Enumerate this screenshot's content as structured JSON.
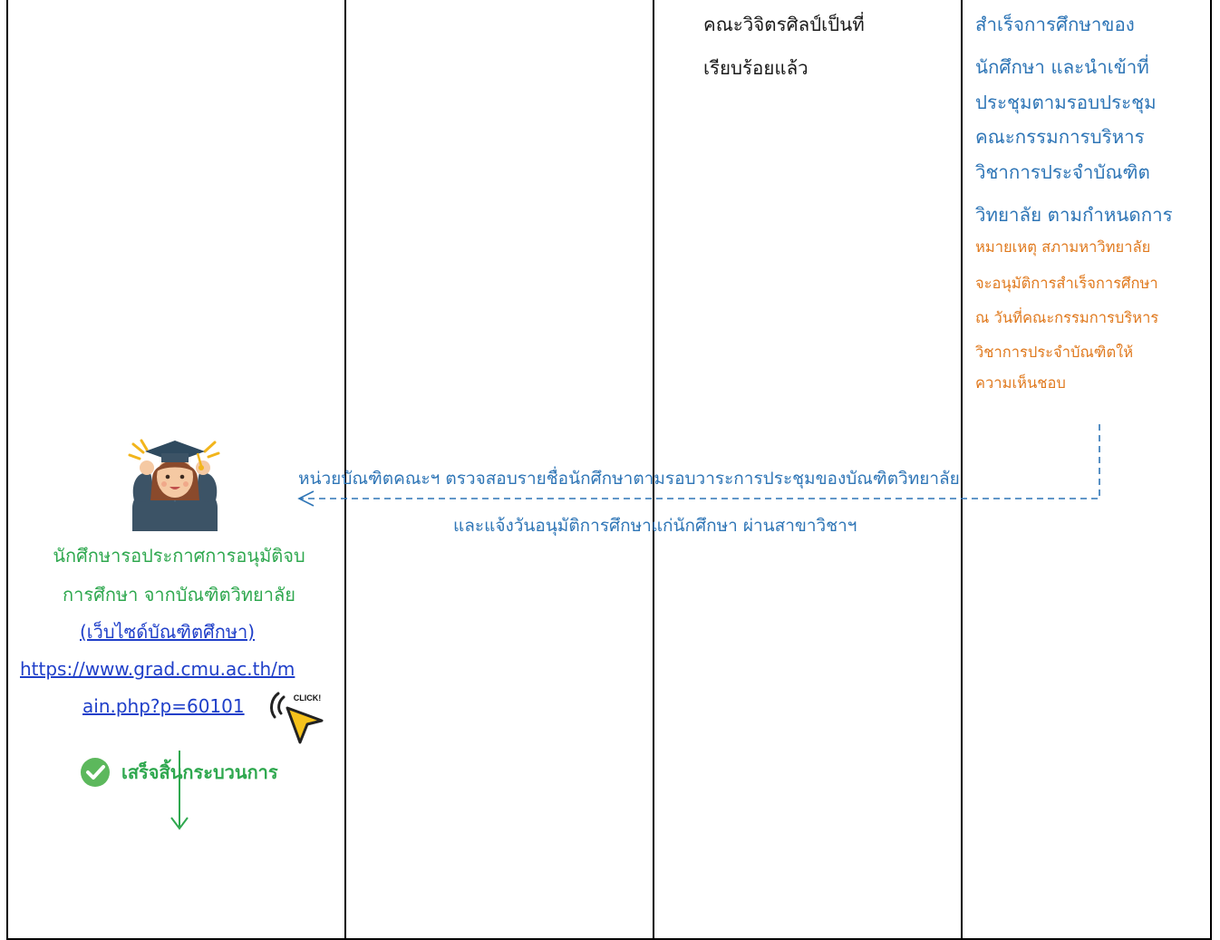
{
  "col3": {
    "lines": [
      "คณะวิจิตรศิลป์เป็นที่",
      "เรียบร้อยแล้ว"
    ]
  },
  "col4": {
    "blue_lines": [
      "สำเร็จการศึกษาของ",
      "นักศึกษา และนำเข้าที่",
      "ประชุมตามรอบประชุม",
      "คณะกรรมการบริหาร",
      "วิชาการประจำบัณฑิต",
      "วิทยาลัย ตามกำหนดการ"
    ],
    "note_lines": [
      "หมายเหตุ สภามหาวิทยาลัย",
      "จะอนุมัติการสำเร็จการศึกษา",
      "ณ วันที่คณะกรรมการบริหาร",
      "วิชาการประจำบัณฑิตให้",
      "ความเห็นชอบ"
    ]
  },
  "flow": {
    "line1": "หน่วยบัณฑิตคณะฯ ตรวจสอบรายชื่อนักศึกษาตามรอบวาระการประชุมของบัณฑิตวิทยาลัย",
    "line2": "และแจ้งวันอนุมัติการศึกษาแก่นักศึกษา ผ่านสาขาวิชาฯ"
  },
  "col1": {
    "green_lines": [
      "นักศึกษารอประกาศการอนุมัติจบ",
      "การศึกษา จากบัณฑิตวิทยาลัย"
    ],
    "link_label": "(เว็บไซด์บัณฑิตศึกษา)",
    "url_line1": "https://www.grad.cmu.ac.th/m",
    "url_line2": "ain.php?p=60101",
    "click_text": "CLICK!",
    "done_label": "เสร็จสิ้นกระบวนการ"
  },
  "colors": {
    "blue": "#2e75b6",
    "orange": "#e07a1f",
    "green": "#2fa84f",
    "link": "#1f3fc9"
  },
  "icons": [
    "graduate-icon",
    "click-cursor-icon",
    "down-arrow-icon",
    "check-circle-icon"
  ]
}
